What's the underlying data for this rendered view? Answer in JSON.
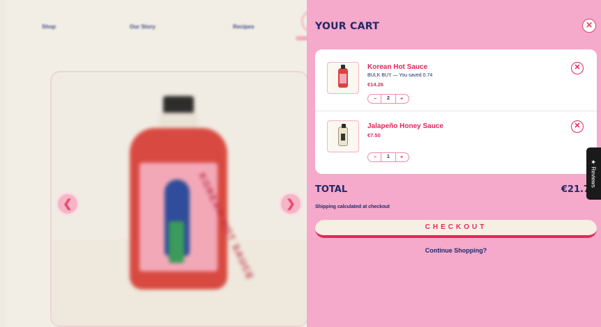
{
  "background": {
    "nav": [
      "Shop",
      "Our Story",
      "Recipes"
    ],
    "product_label_text": "KOREAN HOT SAUCE",
    "prev_icon": "chevron-left-icon",
    "next_icon": "chevron-right-icon"
  },
  "cart": {
    "title": "YOUR CART",
    "close_icon": "close-icon",
    "items": [
      {
        "name": "Korean Hot Sauce",
        "note": "BULK BUY — You saved 0.74",
        "price": "€14.26",
        "qty": "2",
        "minus": "−",
        "plus": "+",
        "remove_icon": "close-icon"
      },
      {
        "name": "Jalapeño Honey Sauce",
        "price": "€7.50",
        "qty": "1",
        "minus": "−",
        "plus": "+",
        "remove_icon": "close-icon"
      }
    ],
    "total_label": "TOTAL",
    "total_value": "€21.7",
    "shipping_note": "Shipping calculated at checkout",
    "checkout_label": "CHECKOUT",
    "continue_label": "Continue Shopping?"
  },
  "reviews_tab": {
    "label": "Reviews",
    "icon": "star-icon"
  },
  "colors": {
    "drawer_bg": "#f5a9cb",
    "accent": "#e4265a",
    "navy": "#1e2a68",
    "cream": "#f6efe3"
  }
}
